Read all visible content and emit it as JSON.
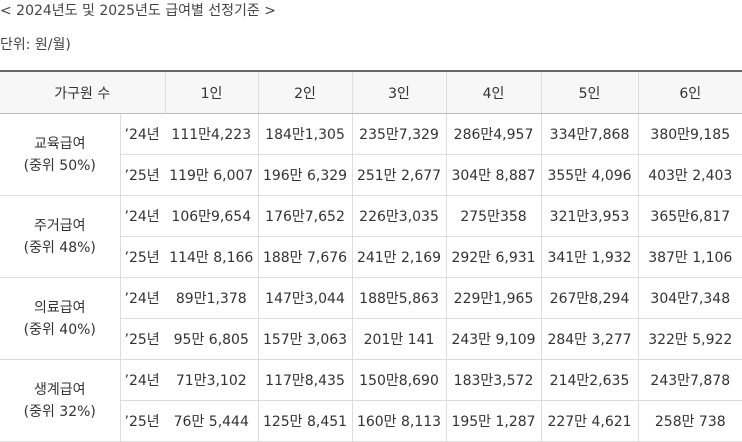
{
  "title": "< 2024년도 및 2025년도 급여별 선정기준 >",
  "unit": "단위: 원/월)",
  "table": {
    "header": {
      "household": "가구원 수",
      "sizes": [
        "1인",
        "2인",
        "3인",
        "4인",
        "5인",
        "6인"
      ]
    },
    "groups": [
      {
        "name": "교육급여",
        "median": "(중위 50%)",
        "rows": [
          {
            "year": "’24년",
            "values": [
              "111만4,223",
              "184만1,305",
              "235만7,329",
              "286만4,957",
              "334만7,868",
              "380만9,185"
            ]
          },
          {
            "year": "’25년",
            "values": [
              "119만 6,007",
              "196만 6,329",
              "251만 2,677",
              "304만 8,887",
              "355만 4,096",
              "403만 2,403"
            ]
          }
        ]
      },
      {
        "name": "주거급여",
        "median": "(중위 48%)",
        "rows": [
          {
            "year": "’24년",
            "values": [
              "106만9,654",
              "176만7,652",
              "226만3,035",
              "275만358",
              "321만3,953",
              "365만6,817"
            ]
          },
          {
            "year": "’25년",
            "values": [
              "114만 8,166",
              "188만 7,676",
              "241만 2,169",
              "292만 6,931",
              "341만 1,932",
              "387만 1,106"
            ]
          }
        ]
      },
      {
        "name": "의료급여",
        "median": "(중위 40%)",
        "rows": [
          {
            "year": "’24년",
            "values": [
              "89만1,378",
              "147만3,044",
              "188만5,863",
              "229만1,965",
              "267만8,294",
              "304만7,348"
            ]
          },
          {
            "year": "’25년",
            "values": [
              "95만 6,805",
              "157만 3,063",
              "201만 141",
              "243만 9,109",
              "284만 3,277",
              "322만 5,922"
            ]
          }
        ]
      },
      {
        "name": "생계급여",
        "median": "(중위 32%)",
        "rows": [
          {
            "year": "’24년",
            "values": [
              "71만3,102",
              "117만8,435",
              "150만8,690",
              "183만3,572",
              "214만2,635",
              "243만7,878"
            ]
          },
          {
            "year": "’25년",
            "values": [
              "76만 5,444",
              "125만 8,451",
              "160만 8,113",
              "195만 1,287",
              "227만 4,621",
              "258만 738"
            ]
          }
        ]
      }
    ]
  }
}
